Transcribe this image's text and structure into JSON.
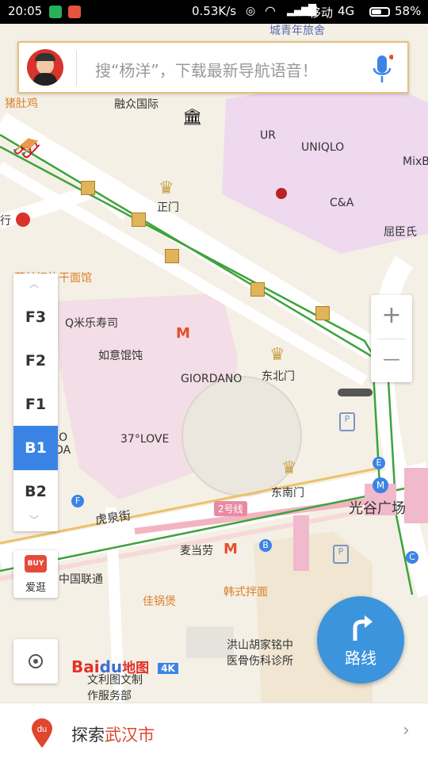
{
  "status_bar": {
    "time": "20:05",
    "network_speed": "0.53K/s",
    "carrier": "移动",
    "network_type": "4G",
    "battery": "58%",
    "battery_level": 0.58
  },
  "search": {
    "placeholder": "搜“杨洋”，下载最新导航语音！",
    "mic_icon": "microphone-icon"
  },
  "map": {
    "road_labels": {
      "line2": "2号线",
      "huquan_street": "虎泉街"
    },
    "pois": [
      {
        "id": "chengqingnian",
        "text": "城青年旅舍",
        "icon": ""
      },
      {
        "id": "zhuduji",
        "text": "猪肚鸡",
        "icon": ""
      },
      {
        "id": "rongzhong",
        "text": "融众国际",
        "icon": ""
      },
      {
        "id": "ur",
        "text": "UR",
        "icon": ""
      },
      {
        "id": "uniqlo",
        "text": "UNIQLO",
        "icon": ""
      },
      {
        "id": "mixbox",
        "text": "MixB",
        "icon": ""
      },
      {
        "id": "zhengmen",
        "text": "正门",
        "icon": ""
      },
      {
        "id": "ca",
        "text": "C&A",
        "icon": ""
      },
      {
        "id": "quchenshi",
        "text": "屈臣氏",
        "icon": ""
      },
      {
        "id": "reganmian",
        "text": "蔡林记热干面馆",
        "icon": ""
      },
      {
        "id": "qmile",
        "text": "Q米乐寿司",
        "icon": ""
      },
      {
        "id": "ruyi",
        "text": "如意馄饨",
        "icon": ""
      },
      {
        "id": "giordano",
        "text": "GIORDANO",
        "icon": ""
      },
      {
        "id": "dongbeimen",
        "text": "东北门",
        "icon": ""
      },
      {
        "id": "vero",
        "text": "VERO\nMODA",
        "icon": ""
      },
      {
        "id": "love37",
        "text": "37°LOVE",
        "icon": ""
      },
      {
        "id": "dongnanmen",
        "text": "东南门",
        "icon": ""
      },
      {
        "id": "guanggu",
        "text": "光谷广场",
        "icon": ""
      },
      {
        "id": "mcd",
        "text": "麦当劳",
        "icon": ""
      },
      {
        "id": "unicom",
        "text": "中国联通",
        "icon": ""
      },
      {
        "id": "hanshi",
        "text": "韩式拌面",
        "icon": ""
      },
      {
        "id": "jiaguo",
        "text": "佳锅煲",
        "icon": ""
      },
      {
        "id": "hongshan",
        "text": "洪山胡家铭中\n医骨伤科诊所",
        "icon": ""
      },
      {
        "id": "wenlian",
        "text": "文利图文制\n作服务部",
        "icon": ""
      },
      {
        "id": "xing",
        "text": "行",
        "icon": ""
      }
    ]
  },
  "floor_selector": {
    "floors": [
      "F3",
      "F2",
      "F1",
      "B1",
      "B2"
    ],
    "active": "B1"
  },
  "aiguang": {
    "badge": "BUY",
    "label": "爱逛"
  },
  "zoom": {
    "in": "+",
    "out": "—"
  },
  "logo": {
    "brand_left": "Bai",
    "brand_mid": "du",
    "brand_right": "地图",
    "quality": "4K"
  },
  "route_button": {
    "label": "路线"
  },
  "bottom_bar": {
    "prefix": "探索",
    "city": "武汉市",
    "du_logo": "du"
  },
  "colors": {
    "accent_blue": "#3b84e5",
    "route_blue": "#3c94dd",
    "metro_line": "#3da33b",
    "city_red": "#e0452e",
    "poi_orange": "#d9822b"
  }
}
